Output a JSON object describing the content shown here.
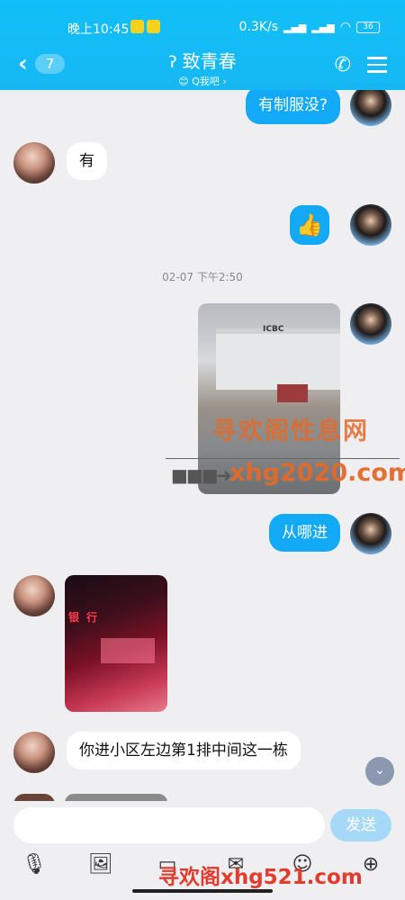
{
  "status_bar": {
    "time": "晚上10:45",
    "network_speed": "0.3K/s",
    "signal_labels": "HD HD",
    "battery": "36"
  },
  "header": {
    "back_badge": "7",
    "title": "致青春",
    "subtitle": "😊 Q我吧 ›",
    "phone_icon": "phone-icon",
    "menu_icon": "menu-icon"
  },
  "messages": [
    {
      "side": "me",
      "type": "text",
      "text": "有制服没?"
    },
    {
      "side": "them",
      "type": "text",
      "text": "有"
    },
    {
      "side": "me",
      "type": "emoji",
      "text": "👍"
    },
    {
      "side": "system",
      "type": "timestamp",
      "text": "02-07 下午2:50"
    },
    {
      "side": "me",
      "type": "image",
      "image_sign": "ICBC"
    },
    {
      "side": "me",
      "type": "text",
      "text": "从哪进"
    },
    {
      "side": "them",
      "type": "image",
      "image_sign": "银 行"
    },
    {
      "side": "them",
      "type": "text",
      "text": "你进小区左边第1排中间这一栋"
    }
  ],
  "watermarks": {
    "line1": "寻欢阁性息网",
    "line2": "xhg2020.com",
    "bottom": "寻欢阁xhg521.com"
  },
  "input": {
    "placeholder": "",
    "send_label": "发送"
  },
  "toolbar": [
    "microphone-icon",
    "image-icon",
    "camera-icon",
    "folder-icon",
    "emoji-icon",
    "plus-icon"
  ]
}
